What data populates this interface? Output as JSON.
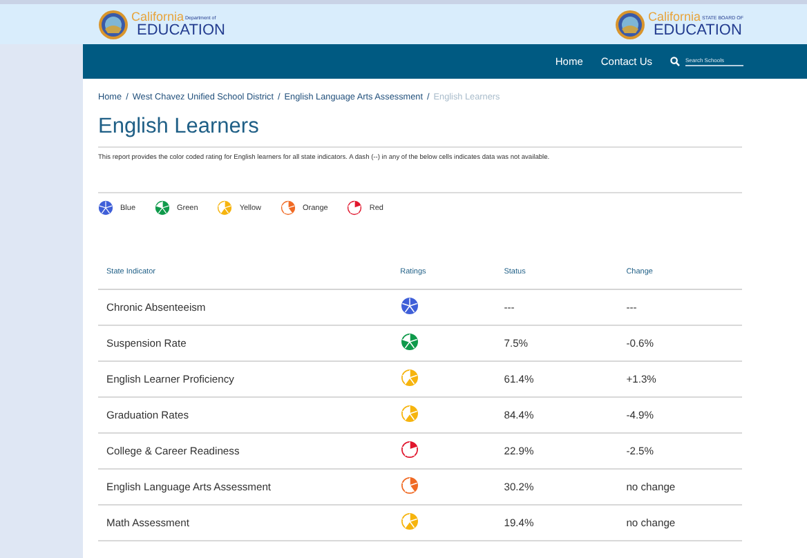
{
  "header": {
    "left_logo": {
      "wordmark": "California",
      "tagline": "Department of",
      "name": "EDUCATION"
    },
    "right_logo": {
      "wordmark": "California",
      "tagline": "STATE BOARD OF",
      "name": "EDUCATION"
    }
  },
  "nav": {
    "links": [
      "Home",
      "Contact Us"
    ],
    "search": {
      "placeholder": "Search Schools"
    }
  },
  "breadcrumb": [
    {
      "label": "Home",
      "separator": "/",
      "current": false
    },
    {
      "label": "West Chavez Unified School District",
      "separator": "/",
      "current": false
    },
    {
      "label": "English Language Arts Assessment",
      "separator": "/",
      "current": false
    },
    {
      "label": "English Learners",
      "current": true
    }
  ],
  "title": "English Learners",
  "description": "This report provides the color coded rating for English learners for all state indicators. A dash (--) in any of the below cells indicates data was not available.",
  "legend": [
    {
      "label": "Blue",
      "kind": "blue",
      "color": "#3f5fd8"
    },
    {
      "label": "Green",
      "kind": "green",
      "color": "#0f9a4b"
    },
    {
      "label": "Yellow",
      "kind": "yellow",
      "color": "#f6b40e"
    },
    {
      "label": "Orange",
      "kind": "orange",
      "color": "#f06a24"
    },
    {
      "label": "Red",
      "kind": "red",
      "color": "#e1162d"
    }
  ],
  "table": {
    "columns": [
      "State Indicator",
      "Ratings",
      "Status",
      "Change"
    ],
    "rows": [
      {
        "indicator": "Chronic Absenteeism",
        "kind": "blue",
        "status": "---",
        "change": "---"
      },
      {
        "indicator": "Suspension Rate",
        "kind": "green",
        "status": "7.5%",
        "change": "-0.6%"
      },
      {
        "indicator": "English Learner Proficiency",
        "kind": "yellow",
        "status": "61.4%",
        "change": "+1.3%"
      },
      {
        "indicator": "Graduation Rates",
        "kind": "yellow",
        "status": "84.4%",
        "change": "-4.9%"
      },
      {
        "indicator": "College & Career Readiness",
        "kind": "red",
        "status": "22.9%",
        "change": "-2.5%"
      },
      {
        "indicator": "English Language Arts Assessment",
        "kind": "orange",
        "status": "30.2%",
        "change": "no change"
      },
      {
        "indicator": "Math Assessment",
        "kind": "yellow",
        "status": "19.4%",
        "change": "no change"
      }
    ]
  }
}
